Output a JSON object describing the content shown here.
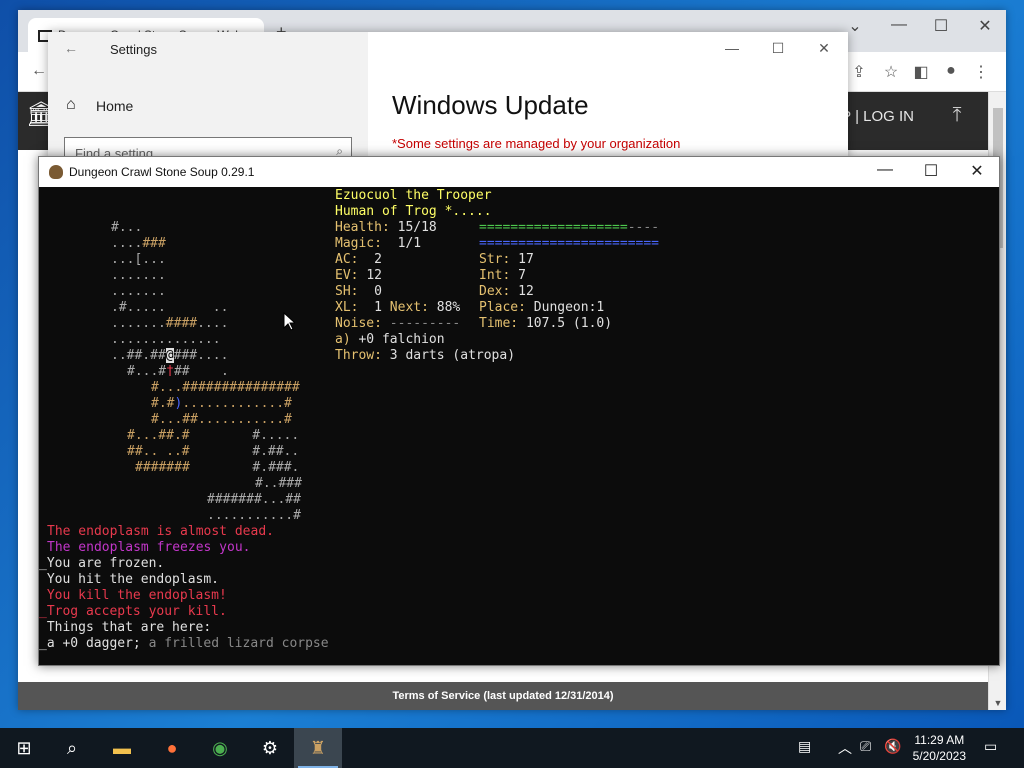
{
  "browser": {
    "tab_title": "Dungeon Crawl Stone Soup - Web...",
    "new_tab": "+",
    "header_login": "UP | LOG IN",
    "footer": "Terms of Service (last updated 12/31/2014)"
  },
  "settings": {
    "title": "Settings",
    "home": "Home",
    "search_placeholder": "Find a setting",
    "heading": "Windows Update",
    "managed_notice": "*Some settings are managed by your organization"
  },
  "dcss": {
    "window_title": "Dungeon Crawl Stone Soup 0.29.1",
    "status": {
      "name": "Ezuocuol the Trooper",
      "species_god": "Human of Trog *.....",
      "health_label": "Health:",
      "health_value": "15/18",
      "health_bar": "===================----",
      "magic_label": "Magic:",
      "magic_value": "1/1",
      "magic_bar": "=======================",
      "ac_label": "AC:",
      "ac_value": "2",
      "str_label": "Str:",
      "str_value": "17",
      "ev_label": "EV:",
      "ev_value": "12",
      "int_label": "Int:",
      "int_value": "7",
      "sh_label": "SH:",
      "sh_value": "0",
      "dex_label": "Dex:",
      "dex_value": "12",
      "xl_label": "XL:",
      "xl_value": "1",
      "next_label": "Next:",
      "next_value": "88%",
      "place_label": "Place:",
      "place_value": "Dungeon:1",
      "noise_label": "Noise:",
      "noise_value": "---------",
      "time_label": "Time:",
      "time_value": "107.5 (1.0)",
      "weapon_slot": "a)",
      "weapon": "+0 falchion",
      "throw_label": "Throw:",
      "throw_value": "3 darts (atropa)"
    },
    "map": {
      "r1": "#...",
      "r2a": "....",
      "r2b": "###",
      "r3": "...[...",
      "r4": ".......",
      "r5": ".......",
      "r6a": ".#.....",
      "r6b": "..",
      "r7a": ".......",
      "r7b": "####",
      "r7c": "....",
      "r8": "..............",
      "r9a": "..##.##",
      "r9at": "@",
      "r9b": "###....",
      "r10a": "#...#",
      "r10b": "†",
      "r10c": "##",
      "r10d": ".",
      "r11": "#...###############",
      "r12a": "#.#",
      "r12b": ")",
      "r12c": ".............#",
      "r13": "#...##...........#",
      "r14a": "#...##.#",
      "r14b": "#.....",
      "r15a": "##.. ..#",
      "r15b": "#.##..",
      "r16a": "#######",
      "r16b": "#.###.",
      "r17": "#..###",
      "r18": "#######...##",
      "r19": "...........#"
    },
    "messages": [
      "The endoplasm is almost dead.",
      "The endoplasm freezes you.",
      "_You are frozen.",
      " You hit the endoplasm.",
      " You kill the endoplasm!",
      "_Trog accepts your kill.",
      " Things that are here:",
      "_a +0 dagger;",
      " a frilled lizard corpse"
    ]
  },
  "taskbar": {
    "time": "11:29 AM",
    "date": "5/20/2023"
  }
}
